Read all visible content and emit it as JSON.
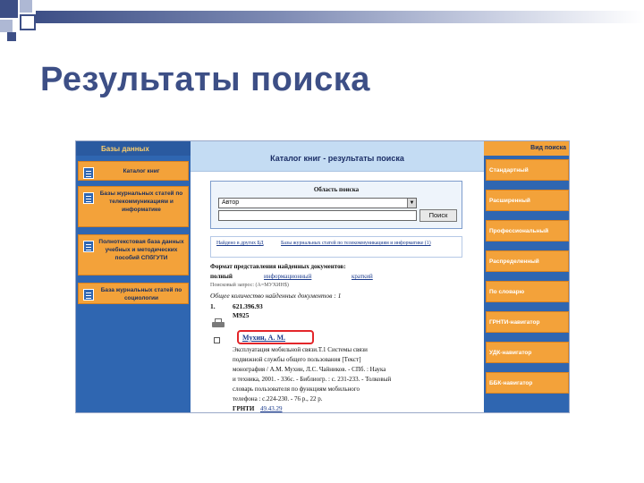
{
  "slide": {
    "title": "Результаты поиска"
  },
  "colors": {
    "title": "#3d4f86",
    "panel_blue": "#2f66b1",
    "menu_orange": "#f3a23a",
    "header_light_blue": "#c4dcf3",
    "highlight_red": "#e3262a"
  },
  "left_panel": {
    "heading": "Базы данных",
    "items": [
      {
        "label": "Каталог книг",
        "icon": "database-icon"
      },
      {
        "label": "Базы журнальных статей по телекоммуникациям и информатике",
        "icon": "database-icon"
      },
      {
        "label": "Полнотекстовая база данных учебных и методических пособий СПбГУТИ",
        "icon": "database-icon"
      },
      {
        "label": "База журнальных статей по социологии",
        "icon": "database-icon"
      }
    ]
  },
  "center": {
    "header": "Каталог книг - результаты поиска",
    "search_area_title": "Область поиска",
    "field_select": "Автор",
    "search_input_value": "",
    "search_button": "Поиск",
    "link_1": "Найдено в других БД",
    "link_2": "Базы журнальных статей по телекоммуникациям и информатике (1)",
    "format_label": "Формат представления найденных документов:",
    "format_full": "полный",
    "format_info": "информационный",
    "format_short": "краткий",
    "query_label": "Поисковый запрос: (А=МУХИН$)",
    "total_label": "Общее количество найденных документов : 1",
    "result": {
      "number": "1.",
      "udc": "621.396.93",
      "code": "М925",
      "author": "Мухин, А. М.",
      "lines": [
        "Эксплуатация мобильной связи.Т.1 Системы связи",
        "подвижной службы общего пользования [Текст]",
        "монография / А.М. Мухин, Л.С. Чайников. - СПб. : Наука",
        "и техника, 2001. - 336с. - Библиогр. : с. 231-233. - Толковый",
        "словарь пользователя по функциям мобильного",
        "телефона : с.224-230. - 76 р., 22 р."
      ],
      "grnti_label": "ГРНТИ",
      "grnti_value": "49.43.29"
    }
  },
  "right_panel": {
    "heading": "Вид поиска",
    "items": [
      "Стандартный",
      "Расширенный",
      "Профессиональный",
      "Распределенный",
      "По словарю",
      "ГРНТИ-навигатор",
      "УДК-навигатор",
      "ББК-навигатор"
    ]
  }
}
